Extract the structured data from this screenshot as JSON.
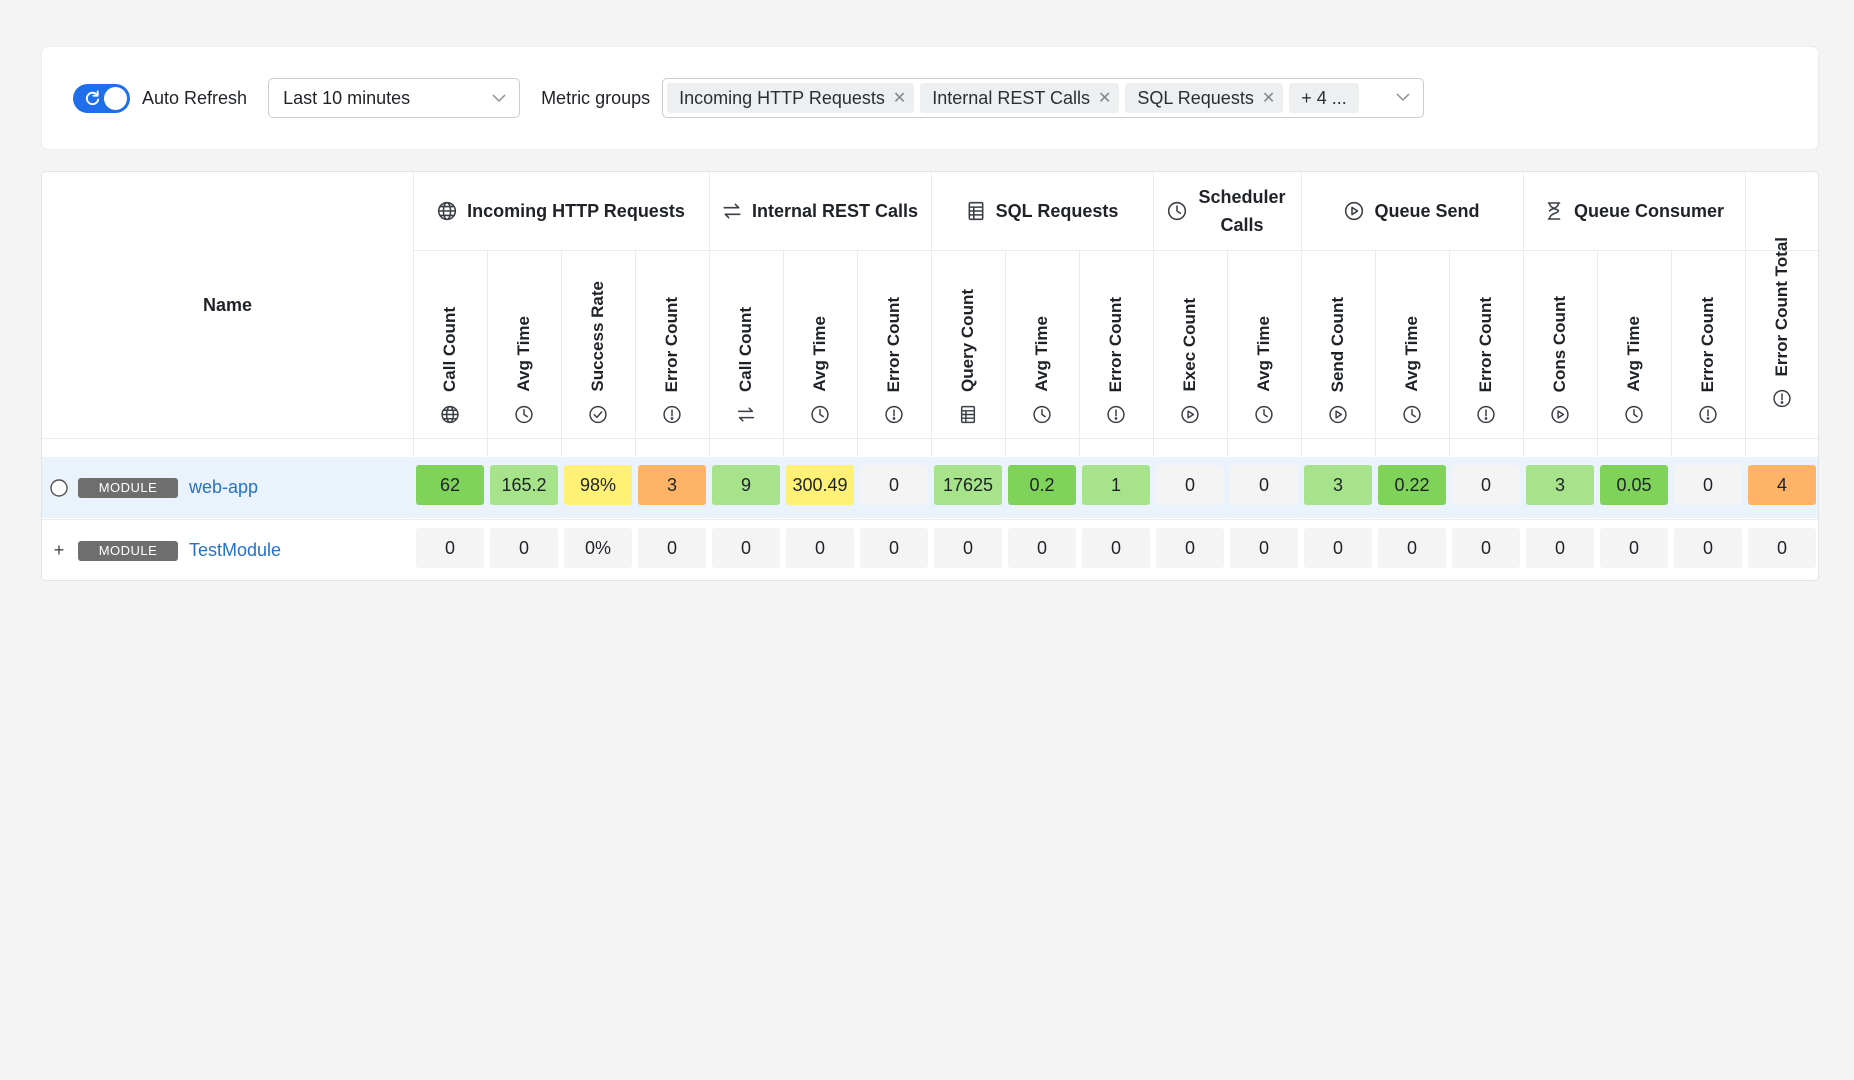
{
  "toolbar": {
    "auto_refresh_label": "Auto Refresh",
    "auto_refresh_on": true,
    "time_range_value": "Last 10 minutes",
    "metric_groups_label": "Metric groups",
    "metric_tags": [
      "Incoming HTTP Requests",
      "Internal REST Calls",
      "SQL Requests"
    ],
    "more_tag": "+ 4 ...",
    "accent_color": "#1f6feb"
  },
  "table": {
    "name_header": "Name",
    "groups": [
      {
        "title": "Incoming HTTP Requests",
        "icon": "globe-icon"
      },
      {
        "title": "Internal REST Calls",
        "icon": "arrows-exchange-icon"
      },
      {
        "title": "SQL Requests",
        "icon": "database-table-icon"
      },
      {
        "title": "Scheduler Calls",
        "icon": "clock-icon"
      },
      {
        "title": "Queue Send",
        "icon": "play-circle-icon"
      },
      {
        "title": "Queue Consumer",
        "icon": "hourglass-icon"
      }
    ],
    "columns": [
      {
        "label": "Call Count",
        "icon": "globe-icon"
      },
      {
        "label": "Avg Time",
        "icon": "clock-icon"
      },
      {
        "label": "Success Rate",
        "icon": "check-circle-icon"
      },
      {
        "label": "Error Count",
        "icon": "alert-circle-icon"
      },
      {
        "label": "Call Count",
        "icon": "arrows-exchange-icon"
      },
      {
        "label": "Avg Time",
        "icon": "clock-icon"
      },
      {
        "label": "Error Count",
        "icon": "alert-circle-icon"
      },
      {
        "label": "Query Count",
        "icon": "database-table-icon"
      },
      {
        "label": "Avg Time",
        "icon": "clock-icon"
      },
      {
        "label": "Error Count",
        "icon": "alert-circle-icon"
      },
      {
        "label": "Exec Count",
        "icon": "play-circle-icon"
      },
      {
        "label": "Avg Time",
        "icon": "clock-icon"
      },
      {
        "label": "Send Count",
        "icon": "play-circle-icon"
      },
      {
        "label": "Avg Time",
        "icon": "clock-icon"
      },
      {
        "label": "Error Count",
        "icon": "alert-circle-icon"
      },
      {
        "label": "Cons Count",
        "icon": "play-circle-icon"
      },
      {
        "label": "Avg Time",
        "icon": "clock-icon"
      },
      {
        "label": "Error Count",
        "icon": "alert-circle-icon"
      },
      {
        "label": "Error Count Total",
        "icon": "alert-circle-icon"
      }
    ],
    "rows": [
      {
        "badge": "MODULE",
        "name": "web-app",
        "expander": "",
        "values": [
          "62",
          "165.2",
          "98%",
          "3",
          "9",
          "300.49",
          "0",
          "17625",
          "0.2",
          "1",
          "0",
          "0",
          "3",
          "0.22",
          "0",
          "3",
          "0.05",
          "0",
          "4"
        ],
        "colors": [
          "#7fd35b",
          "#a6e38b",
          "#fff176",
          "#ffb366",
          "#a6e38b",
          "#fff176",
          "#f4f4f5",
          "#a6e38b",
          "#7fd35b",
          "#a6e38b",
          "#f4f4f5",
          "#f4f4f5",
          "#a6e38b",
          "#7fd35b",
          "#f4f4f5",
          "#a6e38b",
          "#7fd35b",
          "#f4f4f5",
          "#ffb366"
        ]
      },
      {
        "badge": "MODULE",
        "name": "TestModule",
        "expander": "+",
        "values": [
          "0",
          "0",
          "0%",
          "0",
          "0",
          "0",
          "0",
          "0",
          "0",
          "0",
          "0",
          "0",
          "0",
          "0",
          "0",
          "0",
          "0",
          "0",
          "0"
        ],
        "colors": [
          "#f4f4f5",
          "#f4f4f5",
          "#f4f4f5",
          "#f4f4f5",
          "#f4f4f5",
          "#f4f4f5",
          "#f4f4f5",
          "#f4f4f5",
          "#f4f4f5",
          "#f4f4f5",
          "#f4f4f5",
          "#f4f4f5",
          "#f4f4f5",
          "#f4f4f5",
          "#f4f4f5",
          "#f4f4f5",
          "#f4f4f5",
          "#f4f4f5",
          "#f4f4f5"
        ]
      }
    ]
  }
}
